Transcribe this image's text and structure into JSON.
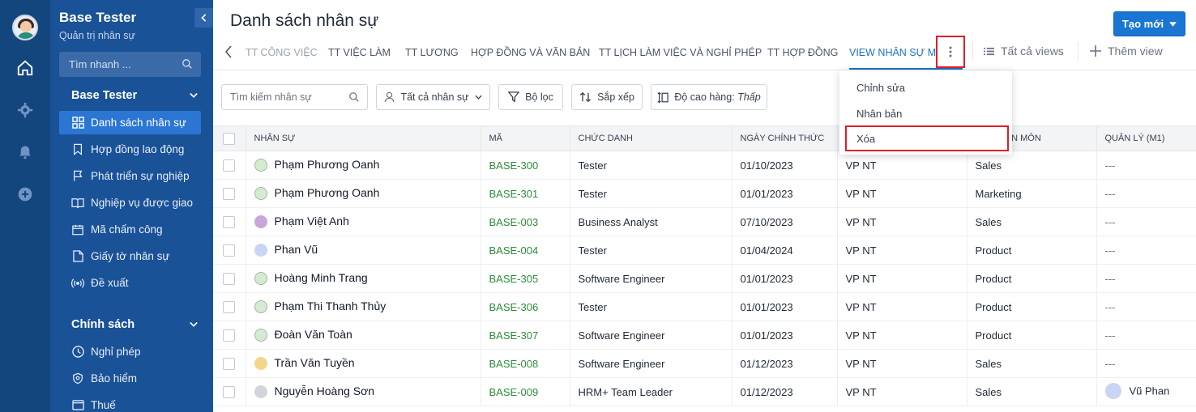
{
  "sidebar": {
    "title": "Base Tester",
    "subtitle": "Quản trị nhân sự",
    "search_placeholder": "Tìm nhanh ...",
    "section1": "Base Tester",
    "items1": [
      {
        "label": "Danh sách nhân sự",
        "icon": "grid-icon",
        "active": true
      },
      {
        "label": "Hợp đồng lao động",
        "icon": "bookmark-icon"
      },
      {
        "label": "Phát triển sự nghiệp",
        "icon": "flag-icon"
      },
      {
        "label": "Nghiệp vụ được giao",
        "icon": "book-icon"
      },
      {
        "label": "Mã chấm công",
        "icon": "calendar-icon"
      },
      {
        "label": "Giấy tờ nhân sự",
        "icon": "document-icon"
      },
      {
        "label": "Đề xuất",
        "icon": "broadcast-icon"
      }
    ],
    "section2": "Chính sách",
    "items2": [
      {
        "label": "Nghỉ phép",
        "icon": "clock-icon"
      },
      {
        "label": "Bảo hiểm",
        "icon": "shield-icon"
      },
      {
        "label": "Thuế",
        "icon": "card-icon"
      }
    ]
  },
  "header": {
    "title": "Danh sách nhân sự",
    "new_button": "Tạo mới"
  },
  "tabs": {
    "items": [
      "TT CÔNG VIỆC",
      "TT VIỆC LÀM",
      "TT LƯƠNG",
      "HỢP ĐỒNG VÀ VĂN BẢN",
      "TT LỊCH LÀM VIỆC VÀ NGHỈ PHÉP",
      "TT HỢP ĐỒNG",
      "VIEW NHÂN SỰ MỚI"
    ],
    "all_views": "Tất cả views",
    "add_view": "Thêm view"
  },
  "toolbar": {
    "search_placeholder": "Tìm kiếm nhân sự",
    "filter_all": "Tất cả nhân sự",
    "filter": "Bộ lọc",
    "sort": "Sắp xếp",
    "row_height_label": "Độ cao hàng:",
    "row_height_value": "Thấp"
  },
  "menu": {
    "items": [
      "Chỉnh sửa",
      "Nhân bản",
      "Xóa"
    ]
  },
  "table": {
    "columns": [
      "NHÂN SỰ",
      "MÃ",
      "CHỨC DANH",
      "NGÀY CHÍNH THỨC",
      "",
      "/ CHUYÊN MÔN",
      "QUẢN LÝ (M1)"
    ],
    "rows": [
      {
        "name": "Phạm Phương Oanh",
        "avatar": "img",
        "code": "BASE-300",
        "title": "Tester",
        "date": "01/10/2023",
        "office": "VP NT",
        "dept": "Sales",
        "manager": "---"
      },
      {
        "name": "Phạm Phương Oanh",
        "avatar": "img",
        "code": "BASE-301",
        "title": "Tester",
        "date": "01/01/2023",
        "office": "VP NT",
        "dept": "Marketing",
        "manager": "---"
      },
      {
        "name": "Phạm Việt Anh",
        "avatar": "purple",
        "code": "BASE-003",
        "title": "Business Analyst",
        "date": "07/10/2023",
        "office": "VP NT",
        "dept": "Sales",
        "manager": "---"
      },
      {
        "name": "Phan Vũ",
        "avatar": "blue",
        "code": "BASE-004",
        "title": "Tester",
        "date": "01/04/2024",
        "office": "VP NT",
        "dept": "Product",
        "manager": "---"
      },
      {
        "name": "Hoàng Minh Trang",
        "avatar": "img",
        "code": "BASE-305",
        "title": "Software Engineer",
        "date": "01/01/2023",
        "office": "VP NT",
        "dept": "Product",
        "manager": "---"
      },
      {
        "name": "Phạm Thi Thanh Thủy",
        "avatar": "img",
        "code": "BASE-306",
        "title": "Tester",
        "date": "01/01/2023",
        "office": "VP NT",
        "dept": "Product",
        "manager": "---"
      },
      {
        "name": "Đoàn Văn Toàn",
        "avatar": "img",
        "code": "BASE-307",
        "title": "Software Engineer",
        "date": "01/01/2023",
        "office": "VP NT",
        "dept": "Product",
        "manager": "---"
      },
      {
        "name": "Trần Văn Tuyền",
        "avatar": "yellow",
        "code": "BASE-008",
        "title": "Software Engineer",
        "date": "01/12/2023",
        "office": "VP NT",
        "dept": "Sales",
        "manager": "---"
      },
      {
        "name": "Nguyễn Hoàng Sơn",
        "avatar": "grey",
        "code": "BASE-009",
        "title": "HRM+ Team Leader",
        "date": "01/12/2023",
        "office": "VP NT",
        "dept": "Sales",
        "manager": "Vũ Phan"
      }
    ]
  },
  "colors": {
    "rail": "#14467e",
    "sidebar": "#1a5298",
    "active_item": "#2b76d3",
    "accent": "#1976d2",
    "code_green": "#2e8b3a",
    "highlight_red": "#e11d2a"
  }
}
